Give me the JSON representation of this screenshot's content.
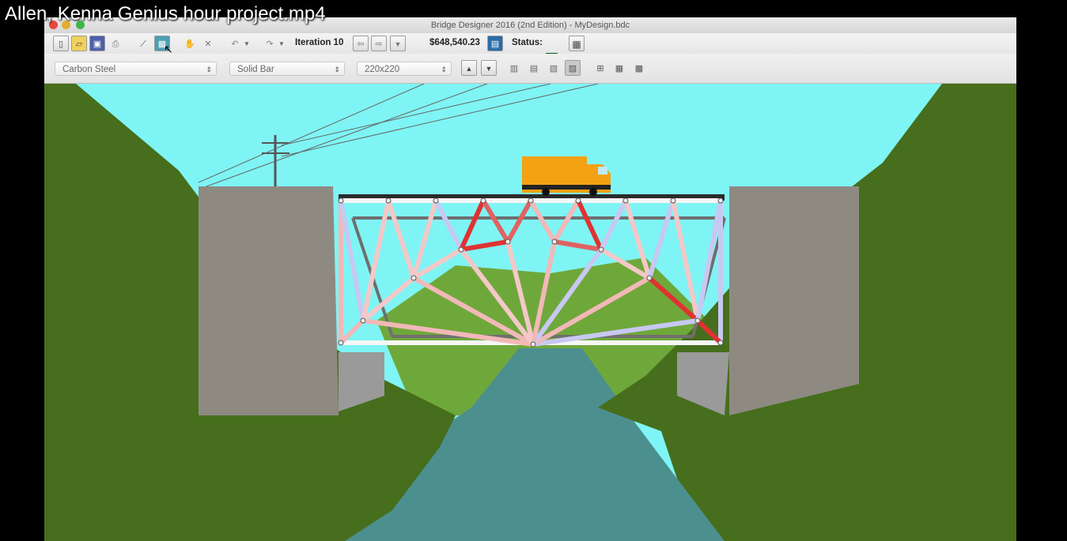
{
  "video": {
    "title": "Allen, Kenna Genius hour project.mp4"
  },
  "window": {
    "title": "Bridge Designer 2016 (2nd Edition) - MyDesign.bdc"
  },
  "toolbar": {
    "iteration_label": "Iteration 10",
    "cost": "$648,540.23",
    "status_label": "Status:",
    "status_symbol": "▲"
  },
  "member_props": {
    "material": "Carbon Steel",
    "cross_section": "Solid Bar",
    "size": "220x220"
  },
  "icons": {
    "new": "new-document-icon",
    "open": "open-folder-icon",
    "save": "save-icon",
    "print": "print-icon",
    "draw": "draw-joints-icon",
    "test": "load-test-icon",
    "select": "select-tool-icon",
    "delete": "delete-icon",
    "undo": "undo-icon",
    "redo": "redo-icon",
    "calculator": "cost-calculator-icon",
    "spreadsheet": "member-table-icon"
  },
  "colors": {
    "sky": "#7ff4f4",
    "water": "#4c8f8f",
    "hill": "#466e1c",
    "truck": "#f4a114",
    "tension": "#e03232",
    "compression": "#8a8ae6"
  }
}
